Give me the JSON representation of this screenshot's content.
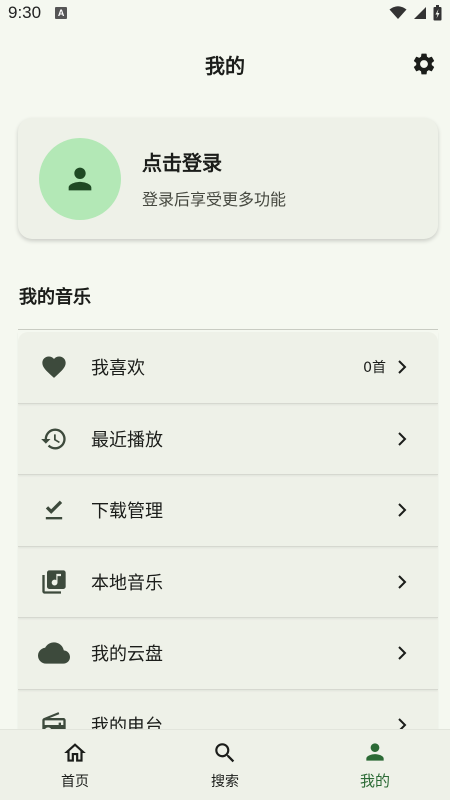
{
  "status_bar": {
    "time": "9:30",
    "notification_glyph": "A"
  },
  "header": {
    "title": "我的",
    "settings_icon": "gear-icon"
  },
  "login_card": {
    "title": "点击登录",
    "subtitle": "登录后享受更多功能",
    "avatar_icon": "person-icon"
  },
  "section": {
    "title": "我的音乐"
  },
  "menu": {
    "items": [
      {
        "label": "我喜欢",
        "count": "0首",
        "icon": "heart-icon"
      },
      {
        "label": "最近播放",
        "icon": "history-icon"
      },
      {
        "label": "下载管理",
        "icon": "download-done-icon"
      },
      {
        "label": "本地音乐",
        "icon": "music-library-icon"
      },
      {
        "label": "我的云盘",
        "icon": "cloud-icon"
      },
      {
        "label": "我的电台",
        "icon": "radio-icon"
      }
    ]
  },
  "bottom_nav": {
    "items": [
      {
        "label": "首页",
        "icon": "home-icon"
      },
      {
        "label": "搜索",
        "icon": "search-icon"
      },
      {
        "label": "我的",
        "icon": "person-icon",
        "active": true
      }
    ]
  },
  "colors": {
    "background": "#f5f8f0",
    "card": "#eef1e8",
    "avatar_bg": "#b3e8b6",
    "accent": "#2b6a35",
    "icon": "#3d4a3c"
  }
}
